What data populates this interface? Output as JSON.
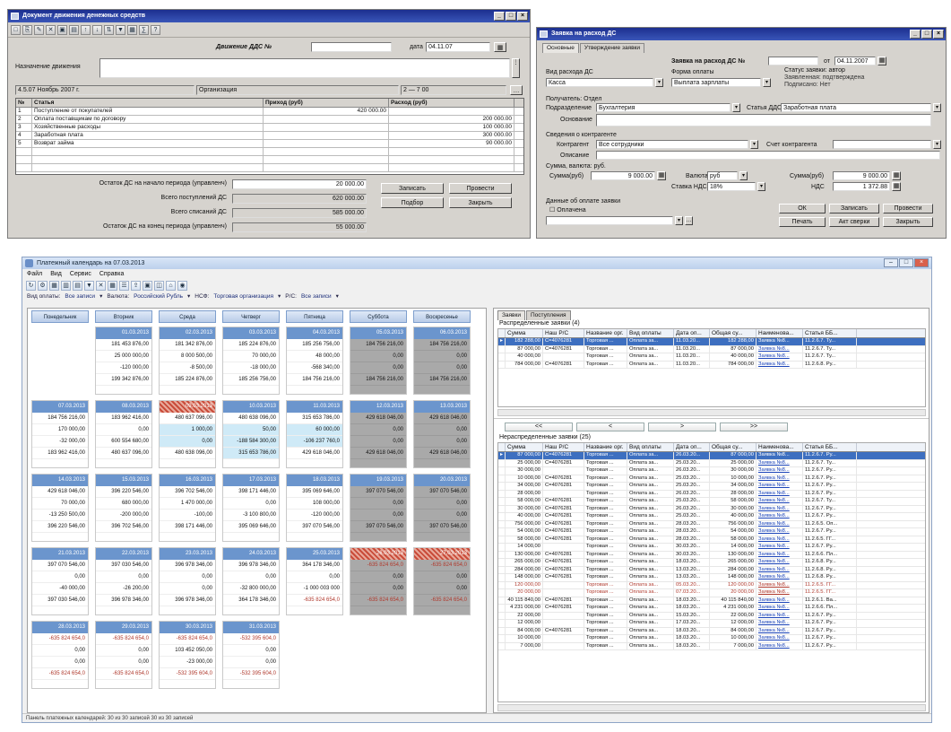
{
  "ddc_window": {
    "title": "Документ движения денежных средств",
    "doc_label": "Движение ДДС №",
    "doc_number": "",
    "date_label": "дата",
    "date_value": "04.11.07",
    "purpose_label": "Назначение движения",
    "purpose_value": "",
    "period_value": "4.5.07 Ноябрь 2007 г.",
    "org_value": "Организация",
    "range_value": "2 — 7 00",
    "table_headers": [
      "№",
      "Статья",
      "Приход (руб)",
      "Расход (руб)"
    ],
    "rows": [
      {
        "n": "1",
        "item": "Поступление от покупателей",
        "income": "420 000.00",
        "expense": ""
      },
      {
        "n": "2",
        "item": "Оплата поставщикам по договору",
        "income": "",
        "expense": "200 000.00"
      },
      {
        "n": "3",
        "item": "Хозяйственные расходы",
        "income": "",
        "expense": "100 000.00"
      },
      {
        "n": "4",
        "item": "Заработная плата",
        "income": "",
        "expense": "300 000.00"
      },
      {
        "n": "5",
        "item": "Возврат займа",
        "income": "",
        "expense": "90 000.00"
      }
    ],
    "summary": [
      {
        "label": "Остаток ДС на начало периода (управленч)",
        "value": "20 000.00"
      },
      {
        "label": "Всего поступлений ДС",
        "value": "620 000.00"
      },
      {
        "label": "Всего списаний ДС",
        "value": "585 000.00"
      },
      {
        "label": "Остаток ДС на конец периода (управленч)",
        "value": "55 000.00"
      }
    ],
    "buttons": [
      "Записать",
      "Провести",
      "Подбор",
      "Закрыть"
    ]
  },
  "request_window": {
    "title": "Заявка на расход ДС",
    "tabs": [
      "Основные",
      "Утверждение заявки"
    ],
    "doc_label": "Заявка на расход ДС №",
    "doc_number": "",
    "date_label": "от",
    "date_value": "04.11.2007",
    "kind_label": "Вид расхода ДС",
    "kind_value": "Касса",
    "purpose_label": "Форма оплаты",
    "purpose_value": "Выплата зарплаты",
    "status_label": "Статус заявки: автор",
    "status_value": "Заявленная: подтверждена",
    "status_value2": "Подписано: Нет",
    "recipient_section": "Получатель: Отдел",
    "division_label": "Подразделение",
    "division_value": "Бухгалтерия",
    "article_label": "Статья ДДС",
    "article_value": "Заработная плата",
    "basis_label": "Основание",
    "basis_value": "",
    "payment_section": "Сведения о контрагенте",
    "counterparty_label": "Контрагент",
    "counterparty_value": "Все сотрудники",
    "contract_label": "Счет контрагента",
    "contract_value": "",
    "comment_label": "Описание",
    "comment_value": "",
    "sum_section": "Сумма, валюта: руб.",
    "sum_label": "Сумма(руб)",
    "sum_value": "9 000.00",
    "currency_label": "Валюта",
    "currency_value": "руб",
    "vat_label": "Ставка НДС",
    "vat_value": "18%",
    "total_label": "Сумма(руб)",
    "total_value": "9 000.00",
    "vat_sum_label": "НДС",
    "vat_sum_value": "1 372.88",
    "approve_section": "Данные об оплате заявки",
    "approve_check": "Оплачена",
    "buttons": [
      "ОК",
      "Записать",
      "Провести",
      "Печать",
      "Акт сверки",
      "Закрыть"
    ]
  },
  "planner": {
    "title": "Платежный календарь на 07.03.2013",
    "menu": [
      "Файл",
      "Вид",
      "Сервис",
      "Справка"
    ],
    "filters": [
      {
        "label": "Вид оплаты:",
        "value": "Все записи"
      },
      {
        "label": "Валюта:",
        "value": "Российский Рубль"
      },
      {
        "label": "НСФ:",
        "value": "Торговая организация"
      },
      {
        "label": "Р/С:",
        "value": "Все записи"
      }
    ],
    "day_headers": [
      "Понедельник",
      "Вторник",
      "Среда",
      "Четверг",
      "Пятница",
      "Суббота",
      "Воскресенье"
    ],
    "weeks": [
      {
        "days": [
          {
            "date": "",
            "lines": [],
            "style": "empty"
          },
          {
            "date": "01.03.2013",
            "lines": [
              "181 453 876,00",
              "25 000 000,00",
              "-120 000,00",
              "199 342 876,00"
            ]
          },
          {
            "date": "02.03.2013",
            "lines": [
              "181 342 876,00",
              "8 000 500,00",
              "-8 500,00",
              "185 224 876,00"
            ]
          },
          {
            "date": "03.03.2013",
            "lines": [
              "185 224 876,00",
              "70 000,00",
              "-18 000,00",
              "185 256 756,00"
            ]
          },
          {
            "date": "04.03.2013",
            "lines": [
              "185 256 756,00",
              "48 000,00",
              "-568 340,00",
              "184 756 216,00"
            ]
          },
          {
            "date": "05.03.2013",
            "lines": [
              "184 756 216,00",
              "0,00",
              "0,00",
              "184 756 216,00"
            ],
            "style": "grey"
          },
          {
            "date": "06.03.2013",
            "lines": [
              "184 756 216,00",
              "0,00",
              "0,00",
              "184 756 216,00"
            ],
            "style": "grey"
          }
        ]
      },
      {
        "days": [
          {
            "date": "07.03.2013",
            "lines": [
              "184 756 216,00",
              "170 000,00",
              "-32 000,00",
              "183 962 416,00"
            ]
          },
          {
            "date": "08.03.2013",
            "lines": [
              "183 962 416,00",
              "0,00",
              "600 554 680,00",
              "480 637 096,00"
            ]
          },
          {
            "date": "09.03.2013",
            "lines": [
              "480 637 096,00",
              "1 000,00",
              "0,00",
              "480 638 096,00"
            ],
            "style": "hatch",
            "blue": [
              1,
              2
            ]
          },
          {
            "date": "10.03.2013",
            "lines": [
              "480 638 096,00",
              "50,00",
              "-188 584 300,00",
              "315 653 786,00"
            ],
            "blue": [
              1,
              2,
              3
            ]
          },
          {
            "date": "11.03.2013",
            "lines": [
              "315 653 786,00",
              "60 000,00",
              "-106 237 760,0",
              "429 618 046,00"
            ],
            "blue": [
              1,
              2
            ]
          },
          {
            "date": "12.03.2013",
            "lines": [
              "429 618 046,00",
              "0,00",
              "0,00",
              "429 618 046,00"
            ],
            "style": "grey"
          },
          {
            "date": "13.03.2013",
            "lines": [
              "429 618 046,00",
              "0,00",
              "0,00",
              "429 618 046,00"
            ],
            "style": "grey"
          }
        ]
      },
      {
        "days": [
          {
            "date": "14.03.2013",
            "lines": [
              "429 618 046,00",
              "70 000,00",
              "-13 250 500,00",
              "396 220 546,00"
            ]
          },
          {
            "date": "15.03.2013",
            "lines": [
              "396 220 546,00",
              "680 000,00",
              "-200 000,00",
              "396 702 546,00"
            ]
          },
          {
            "date": "16.03.2013",
            "lines": [
              "396 702 546,00",
              "1 470 000,00",
              "-100,00",
              "398 171 446,00"
            ]
          },
          {
            "date": "17.03.2013",
            "lines": [
              "398 171 446,00",
              "0,00",
              "-3 100 800,00",
              "395 069 646,00"
            ]
          },
          {
            "date": "18.03.2013",
            "lines": [
              "395 069 646,00",
              "108 000,00",
              "-120 000,00",
              "397 070 546,00"
            ]
          },
          {
            "date": "19.03.2013",
            "lines": [
              "397 070 546,00",
              "0,00",
              "0,00",
              "397 070 546,00"
            ],
            "style": "grey"
          },
          {
            "date": "20.03.2013",
            "lines": [
              "397 070 546,00",
              "0,00",
              "0,00",
              "397 070 546,00"
            ],
            "style": "grey"
          }
        ]
      },
      {
        "days": [
          {
            "date": "21.03.2013",
            "lines": [
              "397 070 546,00",
              "0,00",
              "-40 000,00",
              "397 030 546,00"
            ]
          },
          {
            "date": "22.03.2013",
            "lines": [
              "397 030 546,00",
              "0,00",
              "-26 200,00",
              "396 978 346,00"
            ]
          },
          {
            "date": "23.03.2013",
            "lines": [
              "396 978 346,00",
              "0,00",
              "0,00",
              "396 978 346,00"
            ]
          },
          {
            "date": "24.03.2013",
            "lines": [
              "396 978 346,00",
              "0,00",
              "-32 800 000,00",
              "364 178 346,00"
            ]
          },
          {
            "date": "25.03.2013",
            "lines": [
              "364 178 346,00",
              "0,00",
              "-1 000 003 000",
              "-635 824 654,0"
            ],
            "neg": [
              3
            ]
          },
          {
            "date": "26.03.2013",
            "lines": [
              "-635 824 654,0",
              "0,00",
              "0,00",
              "-635 824 654,0"
            ],
            "style": "grey",
            "neg": [
              0,
              3
            ],
            "red": true
          },
          {
            "date": "27.03.2013",
            "lines": [
              "-635 824 654,0",
              "0,00",
              "0,00",
              "-635 824 654,0"
            ],
            "style": "grey",
            "neg": [
              0,
              3
            ],
            "red": true
          }
        ]
      },
      {
        "days": [
          {
            "date": "28.03.2013",
            "lines": [
              "-635 824 654,0",
              "0,00",
              "0,00",
              "-635 824 654,0"
            ],
            "neg": [
              0,
              3
            ]
          },
          {
            "date": "29.03.2013",
            "lines": [
              "-635 824 654,0",
              "0,00",
              "0,00",
              "-635 824 654,0"
            ],
            "neg": [
              0,
              3
            ]
          },
          {
            "date": "30.03.2013",
            "lines": [
              "-635 824 654,0",
              "103 452 050,00",
              "-23 000,00",
              "-532 395 604,0"
            ],
            "neg": [
              0,
              3
            ]
          },
          {
            "date": "31.03.2013",
            "lines": [
              "-532 395 604,0",
              "0,00",
              "0,00",
              "-532 395 604,0"
            ],
            "neg": [
              0,
              3
            ]
          }
        ]
      }
    ],
    "right_tabs": [
      "Заявки",
      "Поступления"
    ],
    "top_grid_title": "Распределенные заявки (4)",
    "grid_headers": [
      "Сумма",
      "Наш Р/С",
      "Название орг.",
      "Вид оплаты",
      "Дата оп...",
      "Общая су...",
      "Наименова...",
      "Статья ББ..."
    ],
    "top_rows": [
      {
        "c": [
          "182 288,00",
          "С=4076281",
          "Торговая ...",
          "Оплата за...",
          "11.03.20...",
          "182 288,00",
          "Заявка №8...",
          "11.2.6.7. Ту..."
        ],
        "sel": true
      },
      {
        "c": [
          "87 000,00",
          "С=4076281",
          "Торговая ...",
          "Оплата за...",
          "11.03.20...",
          "87 000,00",
          "Заявка №8...",
          "11.2.6.7. Ту..."
        ]
      },
      {
        "c": [
          "40 000,00",
          "",
          "Торговая ...",
          "Оплата за...",
          "11.03.20...",
          "40 000,00",
          "Заявка №8...",
          "11.2.6.7. Ту..."
        ]
      },
      {
        "c": [
          "784 000,00",
          "С=4076281",
          "Торговая ...",
          "Оплата за...",
          "11.03.20...",
          "784 000,00",
          "Заявка №8...",
          "11.2.6.8. Ру..."
        ]
      }
    ],
    "nav_buttons": [
      "<<",
      "<",
      ">",
      ">>"
    ],
    "bottom_grid_title": "Нераспределенные заявки (25)",
    "bottom_rows": [
      {
        "c": [
          "87 000,00",
          "С=4076281",
          "Торговая ...",
          "Оплата за...",
          "26.03.20...",
          "87 000,00",
          "Заявка №8...",
          "11.2.6.7. Ру..."
        ],
        "sel": true
      },
      {
        "c": [
          "25 000,00",
          "С=4076281",
          "Торговая ...",
          "Оплата за...",
          "25.03.20...",
          "25 000,00",
          "Заявка №8...",
          "11.2.6.7. Ту..."
        ]
      },
      {
        "c": [
          "30 000,00",
          "",
          "Торговая ...",
          "Оплата за...",
          "26.03.20...",
          "30 000,00",
          "Заявка №8...",
          "11.2.6.7. Ру..."
        ]
      },
      {
        "c": [
          "10 000,00",
          "С=4076281",
          "Торговая ...",
          "Оплата за...",
          "25.03.20...",
          "10 000,00",
          "Заявка №8...",
          "11.2.6.7. Ру..."
        ]
      },
      {
        "c": [
          "34 000,00",
          "С=4076281",
          "Торговая ...",
          "Оплата за...",
          "25.03.20...",
          "34 000,00",
          "Заявка №8...",
          "11.2.6.7. Ру..."
        ]
      },
      {
        "c": [
          "28 000,00",
          "",
          "Торговая ...",
          "Оплата за...",
          "26.03.20...",
          "28 000,00",
          "Заявка №8...",
          "11.2.6.7. Ру..."
        ]
      },
      {
        "c": [
          "58 000,00",
          "С=4076281",
          "Торговая ...",
          "Оплата за...",
          "25.03.20...",
          "58 000,00",
          "Заявка №8...",
          "11.2.6.7. Ту..."
        ]
      },
      {
        "c": [
          "30 000,00",
          "С=4076281",
          "Торговая ...",
          "Оплата за...",
          "26.03.20...",
          "30 000,00",
          "Заявка №8...",
          "11.2.6.7. Ру..."
        ]
      },
      {
        "c": [
          "40 000,00",
          "С=4076281",
          "Торговая ...",
          "Оплата за...",
          "25.03.20...",
          "40 000,00",
          "Заявка №8...",
          "11.2.6.7. Ру..."
        ]
      },
      {
        "c": [
          "756 000,00",
          "С=4076281",
          "Торговая ...",
          "Оплата за...",
          "28.03.20...",
          "756 000,00",
          "Заявка №8...",
          "11.2.6.5. Оп..."
        ]
      },
      {
        "c": [
          "54 000,00",
          "С=4076281",
          "Торговая ...",
          "Оплата за...",
          "28.03.20...",
          "54 000,00",
          "Заявка №8...",
          "11.2.6.7. Ру..."
        ]
      },
      {
        "c": [
          "58 000,00",
          "С=4076281",
          "Торговая ...",
          "Оплата за...",
          "28.03.20...",
          "58 000,00",
          "Заявка №8...",
          "11.2.6.5. ГГ..."
        ]
      },
      {
        "c": [
          "14 000,00",
          "",
          "Торговая ...",
          "Оплата за...",
          "30.03.20...",
          "14 000,00",
          "Заявка №8...",
          "11.2.6.7. Ру..."
        ]
      },
      {
        "c": [
          "130 000,00",
          "С=4076281",
          "Торговая ...",
          "Оплата за...",
          "30.03.20...",
          "130 000,00",
          "Заявка №8...",
          "11.2.6.6. Пл..."
        ]
      },
      {
        "c": [
          "265 000,00",
          "С=4076281",
          "Торговая ...",
          "Оплата за...",
          "18.03.20...",
          "265 000,00",
          "Заявка №8...",
          "11.2.6.8. Ру..."
        ]
      },
      {
        "c": [
          "284 000,00",
          "С=4076281",
          "Торговая ...",
          "Оплата за...",
          "13.03.20...",
          "284 000,00",
          "Заявка №8...",
          "11.2.6.8. Ру..."
        ]
      },
      {
        "c": [
          "148 000,00",
          "С=4076281",
          "Торговая ...",
          "Оплата за...",
          "13.03.20...",
          "148 000,00",
          "Заявка №8...",
          "11.2.6.8. Ру..."
        ]
      },
      {
        "c": [
          "120 000,00",
          "",
          "Торговая ...",
          "Оплата за...",
          "05.03.20...",
          "120 000,00",
          "Заявка №8...",
          "11.2.6.5. ГГ..."
        ],
        "red": true
      },
      {
        "c": [
          "20 000,00",
          "",
          "Торговая ...",
          "Оплата за...",
          "07.03.20...",
          "20 000,00",
          "Заявка №8...",
          "11.2.6.5. ГГ..."
        ],
        "red": true
      },
      {
        "c": [
          "40 115 840,00",
          "С=4076281",
          "Торговая ...",
          "Оплата за...",
          "18.03.20...",
          "40 115 840,00",
          "Заявка №8...",
          "11.2.6.1. Ва..."
        ]
      },
      {
        "c": [
          "4 231 000,00",
          "С=4076281",
          "Торговая ...",
          "Оплата за...",
          "18.03.20...",
          "4 231 000,00",
          "Заявка №8...",
          "11.2.6.6. Пл..."
        ]
      },
      {
        "c": [
          "22 000,00",
          "",
          "Торговая ...",
          "Оплата за...",
          "15.03.20...",
          "22 000,00",
          "Заявка №8...",
          "11.2.6.7. Ру..."
        ]
      },
      {
        "c": [
          "12 000,00",
          "",
          "Торговая ...",
          "Оплата за...",
          "17.03.20...",
          "12 000,00",
          "Заявка №8...",
          "11.2.6.7. Ру..."
        ]
      },
      {
        "c": [
          "84 000,00",
          "С=4076281",
          "Торговая ...",
          "Оплата за...",
          "18.03.20...",
          "84 000,00",
          "Заявка №8...",
          "11.2.6.7. Ру..."
        ]
      },
      {
        "c": [
          "10 000,00",
          "",
          "Торговая ...",
          "Оплата за...",
          "18.03.20...",
          "10 000,00",
          "Заявка №8...",
          "11.2.6.7. Ру..."
        ]
      },
      {
        "c": [
          "7 000,00",
          "",
          "Торговая ...",
          "Оплата за...",
          "18.03.20...",
          "7 000,00",
          "Заявка №8...",
          "11.2.6.7. Ру..."
        ]
      }
    ],
    "status_text": "Панель платежных календарей: 30 из 30 записей   30 из 30 записей"
  }
}
